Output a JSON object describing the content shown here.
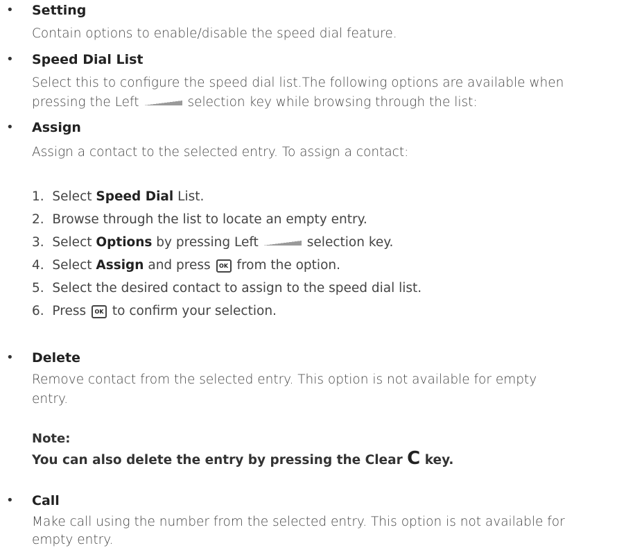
{
  "bullet_char": "•",
  "setting": {
    "title": "Setting",
    "desc": "Contain options to enable/disable the speed dial feature."
  },
  "speed_dial_list": {
    "title": "Speed Dial List",
    "desc_line1": "Select this to configure the speed dial list.The following options are available when",
    "desc_line2_a": "pressing the Left",
    "desc_line2_b": "selection key while browsing through the list:"
  },
  "assign": {
    "title": "Assign",
    "desc": "Assign a contact to the selected entry. To assign a contact:",
    "steps": [
      {
        "num": "1.",
        "pre": "Select ",
        "bold": "Speed Dial",
        "post": " List."
      },
      {
        "num": "2.",
        "pre": "Browse through the list to locate an empty entry.",
        "bold": "",
        "post": ""
      },
      {
        "num": "3.",
        "pre": "Select ",
        "bold": "Options",
        "post": " by pressing Left",
        "post2": "selection key."
      },
      {
        "num": "4.",
        "pre": "Select ",
        "bold": "Assign",
        "post": " and press",
        "post2": "from the option."
      },
      {
        "num": "5.",
        "pre": "Select the desired contact to assign to the speed dial list.",
        "bold": "",
        "post": ""
      },
      {
        "num": "6.",
        "pre": "Press",
        "bold": "",
        "post": "to confirm your selection."
      }
    ],
    "ok_key_label": "OK"
  },
  "delete": {
    "title": "Delete",
    "desc_line1": "Remove contact from the selected entry. This option is not available for empty",
    "desc_line2": "entry.",
    "note_title": "Note:",
    "note_text_a": "You can also delete the entry by pressing the Clear",
    "note_key": "C",
    "note_text_b": "key."
  },
  "call": {
    "title": "Call",
    "desc_line1": "Make call using the number from the selected entry. This option is not available for",
    "desc_line2": "empty entry."
  }
}
